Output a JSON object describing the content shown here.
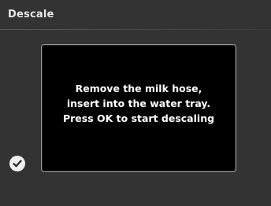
{
  "header": {
    "title": "Descale"
  },
  "message": {
    "lines": [
      "Remove the milk hose,",
      "insert into the water tray.",
      "Press OK to start descaling"
    ]
  },
  "confirm": {
    "icon": "checkmark-icon"
  },
  "colors": {
    "background": "#333333",
    "panel": "#000000",
    "panel_border": "#9a9a9a",
    "text": "#ffffff"
  }
}
